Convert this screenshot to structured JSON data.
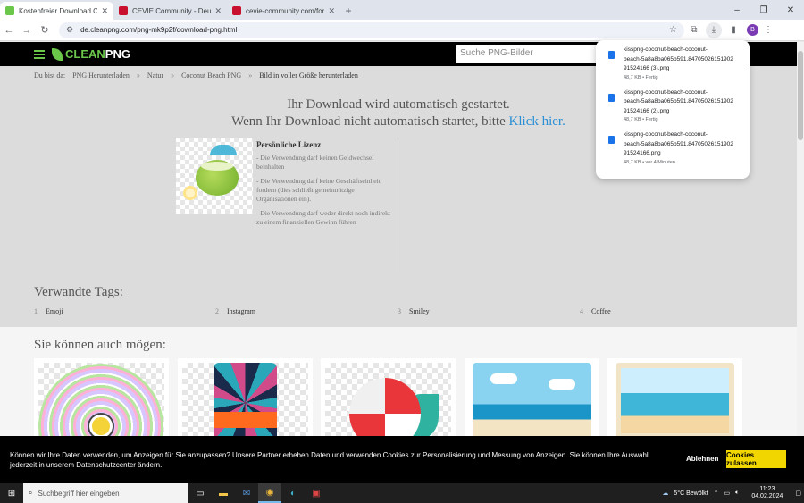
{
  "browser": {
    "tabs": [
      {
        "title": "Kostenfreier Download Coconu...",
        "favicon_color": "#6bc74a",
        "active": true
      },
      {
        "title": "CEVIE Community - Deutschlan...",
        "favicon_color": "#c8102e",
        "active": false
      },
      {
        "title": "cevie-community.com/forum/...",
        "favicon_color": "#c8102e",
        "active": false
      }
    ],
    "new_tab": "+",
    "url": "de.cleanpng.com/png-mk9p2f/download-png.html"
  },
  "site": {
    "logo_clean": "CLEAN",
    "logo_png": "PNG",
    "search_placeholder": "Suche PNG-Bilder"
  },
  "breadcrumb": {
    "prefix": "Du bist da:",
    "items": [
      "PNG Herunterladen",
      "Natur",
      "Coconut Beach PNG",
      "Bild in voller Größe herunterladen"
    ],
    "separator": "»"
  },
  "download_message": {
    "line1": "Ihr Download wird automatisch gestartet.",
    "line2": "Wenn Ihr Download nicht automatisch startet, bitte",
    "link": "Klick hier."
  },
  "license": {
    "title": "Persönliche Lizenz",
    "points": [
      "- Die Verwendung darf keinen Geldwechsel beinhalten",
      "- Die Verwendung darf keine Geschäftseinheit fordern (dies schließt gemeinnützige Organisationen ein).",
      "- Die Verwendung darf weder direkt noch indirekt zu einem finanziellen Gewinn führen"
    ]
  },
  "related": {
    "title": "Verwandte Tags:",
    "tags": [
      {
        "num": "1",
        "label": "Emoji"
      },
      {
        "num": "2",
        "label": "Instagram"
      },
      {
        "num": "3",
        "label": "Smiley"
      },
      {
        "num": "4",
        "label": "Coffee"
      }
    ]
  },
  "may_also_like": {
    "title": "Sie können auch mögen:"
  },
  "downloads": [
    {
      "name_l1": "kisspng-coconut-beach-coconut-",
      "name_l2": "beach-5a8a8ba065b591.84705026151902",
      "name_l3": "91524166 (3).png",
      "meta": "48,7 KB • Fertig"
    },
    {
      "name_l1": "kisspng-coconut-beach-coconut-",
      "name_l2": "beach-5a8a8ba065b591.84705026151902",
      "name_l3": "91524166 (2).png",
      "meta": "48,7 KB • Fertig"
    },
    {
      "name_l1": "kisspng-coconut-beach-coconut-",
      "name_l2": "beach-5a8a8ba065b591.84705026151902",
      "name_l3": "91524166.png",
      "meta": "48,7 KB • vor 4 Minuten"
    }
  ],
  "cookie": {
    "text": "Können wir Ihre Daten verwenden, um Anzeigen für Sie anzupassen? Unsere Partner erheben Daten und verwenden Cookies zur Personalisierung und Messung von Anzeigen. Sie können Ihre Auswahl jederzeit in unserem Datenschutzcenter ändern.",
    "decline": "Ablehnen",
    "accept": "Cookies zulassen"
  },
  "taskbar": {
    "search_placeholder": "Suchbegriff hier eingeben",
    "weather": "5°C  Bewölkt",
    "time": "11:23",
    "date": "04.02.2024"
  }
}
